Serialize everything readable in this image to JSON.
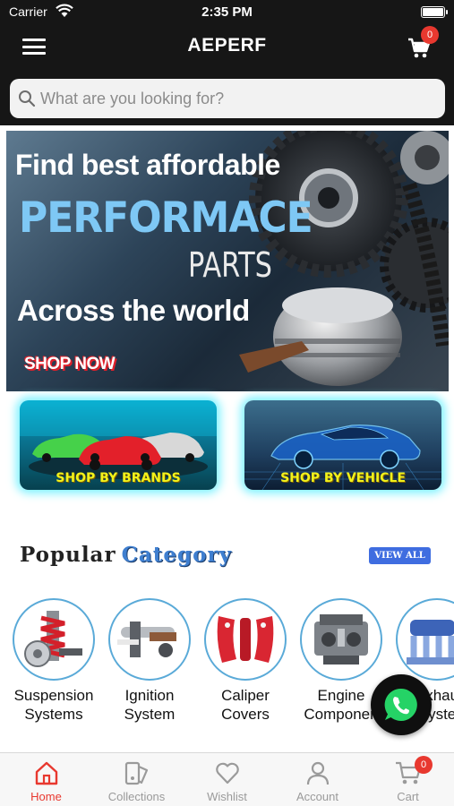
{
  "status_bar": {
    "carrier": "Carrier",
    "time": "2:35 PM"
  },
  "header": {
    "title": "AEPERF",
    "cart_count": "0"
  },
  "search": {
    "placeholder": "What are you looking for?"
  },
  "hero": {
    "line1": "Find best affordable",
    "line2": "PERFORMACE",
    "line3": "PARTS",
    "line4": "Across the world",
    "cta": "SHOP NOW"
  },
  "shop_tiles": [
    {
      "label": "SHOP BY BRANDS"
    },
    {
      "label": "SHOP BY VEHICLE"
    }
  ],
  "popular": {
    "word1": "Popular",
    "word2": "Category",
    "view_all": "VIEW ALL"
  },
  "categories": [
    {
      "line1": "Suspension",
      "line2": "Systems",
      "icon": "suspension-icon"
    },
    {
      "line1": "Ignition",
      "line2": "System",
      "icon": "ignition-icon"
    },
    {
      "line1": "Caliper",
      "line2": "Covers",
      "icon": "caliper-icon"
    },
    {
      "line1": "Engine",
      "line2": "Componen",
      "icon": "engine-icon"
    },
    {
      "line1": "Exhau",
      "line2": "Syste",
      "icon": "exhaust-icon"
    }
  ],
  "tabs": [
    {
      "label": "Home",
      "icon": "home-icon",
      "active": true
    },
    {
      "label": "Collections",
      "icon": "collections-icon"
    },
    {
      "label": "Wishlist",
      "icon": "heart-icon"
    },
    {
      "label": "Account",
      "icon": "user-icon"
    },
    {
      "label": "Cart",
      "icon": "cart-icon",
      "badge": "0"
    }
  ],
  "colors": {
    "accent": "#e8382f",
    "topbar": "#161616",
    "whatsapp": "#25d366",
    "link_blue": "#3f6de0"
  }
}
